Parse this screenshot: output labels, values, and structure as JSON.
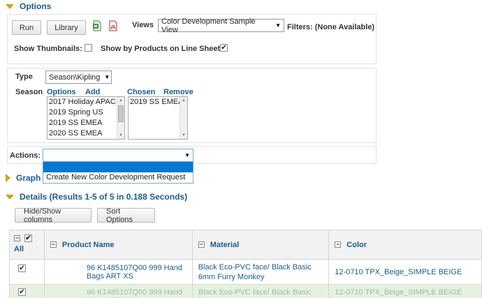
{
  "options": {
    "title": "Options",
    "run_label": "Run",
    "library_label": "Library",
    "views_label": "Views",
    "view_selected": "Color Development Sample View",
    "filters_text": "Filters: (None Available)",
    "show_thumbnails_label": "Show Thumbnails:",
    "show_by_products_label": "Show by Products on Line Sheet:",
    "show_thumbnails_checked": false,
    "show_by_products_checked": true
  },
  "filters": {
    "type_label": "Type",
    "type_value": "Season\\Kipling",
    "season_label": "Season",
    "options_label": "Options",
    "add_label": "Add",
    "chosen_label": "Chosen",
    "remove_label": "Remove",
    "options_list": [
      "2017 Holiday APAC",
      "2019 Spring US",
      "2019 SS EMEA",
      "2020 SS EMEA"
    ],
    "chosen_list": [
      "2019 SS EMEA"
    ]
  },
  "actions": {
    "label": "Actions:",
    "menu_items": [
      "",
      "Create New Color Development Request"
    ]
  },
  "graph": {
    "title": "Graph"
  },
  "details": {
    "title": "Details (Results 1-5 of 5 in 0.188 Seconds)",
    "hide_show_label": "Hide/Show columns",
    "sort_options_label": "Sort Options",
    "all_label": "All",
    "columns": [
      "Product Name",
      "Material",
      "Color"
    ],
    "rows": [
      {
        "product": "96 K1485107Q00 999 Hand Bags ART XS",
        "material": "Black Eco-PVC face/ Black Basic 6mm Furry Monkey",
        "color": "12-0710 TPX_Beige_SIMPLE BEIGE"
      },
      {
        "product": "96 K1485107Q00 999 Hand Bags ART XS",
        "material": "Black Eco-PVC face/ Black Basic 6mm",
        "color": "12-0710 TPX_Beige_SIMPLE BEIGE"
      }
    ]
  }
}
